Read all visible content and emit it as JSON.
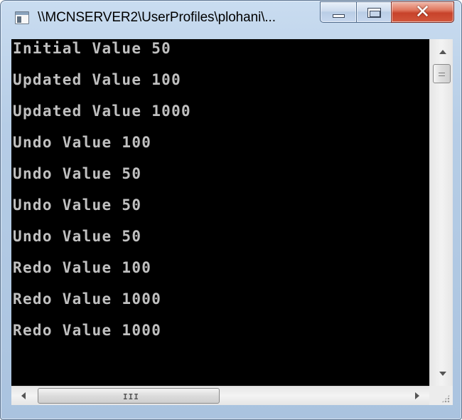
{
  "window": {
    "title": "\\\\MCNSERVER2\\UserProfiles\\plohani\\...",
    "close_glyph": "✕",
    "title_icon": "console-window-icon"
  },
  "console": {
    "background": "#000000",
    "text_color": "#c0c0c0",
    "lines": [
      "Initial Value 50",
      "Updated Value 100",
      "Updated Value 1000",
      "Undo Value 100",
      "Undo Value 50",
      "Undo Value 50",
      "Undo Value 50",
      "Redo Value 100",
      "Redo Value 1000",
      "Redo Value 1000"
    ]
  },
  "scrollbar": {
    "horizontal_grip": "III"
  },
  "colors": {
    "close_button": "#c7422a",
    "frame": "#b6cde6"
  }
}
